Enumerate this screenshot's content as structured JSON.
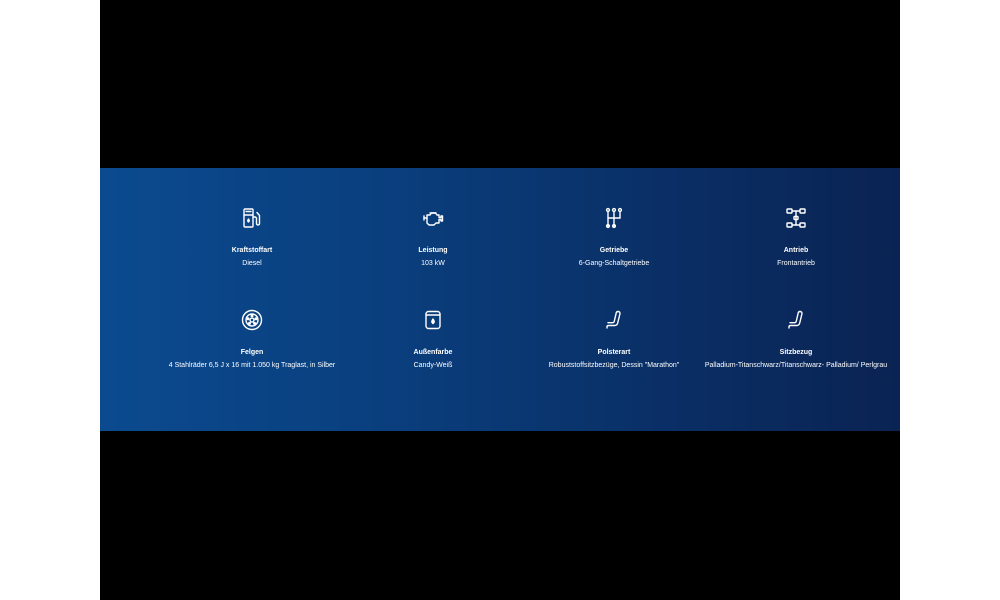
{
  "specs": [
    {
      "icon": "fuel-pump-icon",
      "label": "Kraftstoffart",
      "value": "Diesel"
    },
    {
      "icon": "engine-icon",
      "label": "Leistung",
      "value": "103 kW"
    },
    {
      "icon": "gearshift-icon",
      "label": "Getriebe",
      "value": "6-Gang-Schaltgetriebe"
    },
    {
      "icon": "drivetrain-icon",
      "label": "Antrieb",
      "value": "Frontantrieb"
    },
    {
      "icon": "wheel-icon",
      "label": "Felgen",
      "value": "4 Stahlräder 6,5 J x 16 mit 1.050 kg Traglast, in Silber"
    },
    {
      "icon": "paint-can-icon",
      "label": "Außenfarbe",
      "value": "Candy-Weiß"
    },
    {
      "icon": "seat-icon",
      "label": "Polsterart",
      "value": "Robuststoffsitzbezüge, Dessin \"Marathon\""
    },
    {
      "icon": "seat-icon",
      "label": "Sitzbezug",
      "value": "Palladium-Titanschwarz/Titanschwarz- Palladium/ Perlgrau"
    }
  ],
  "colors": {
    "panel_start": "#0b4a8f",
    "panel_end": "#0a2353",
    "text": "#ffffff"
  }
}
